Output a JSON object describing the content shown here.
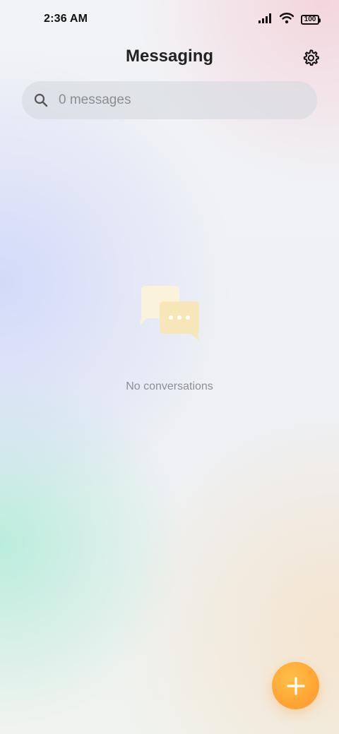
{
  "status_bar": {
    "time": "2:36 AM",
    "battery_level": "100",
    "icons": [
      "signal-icon",
      "wifi-icon",
      "battery-icon"
    ]
  },
  "header": {
    "title": "Messaging",
    "settings_icon": "gear-icon"
  },
  "search": {
    "placeholder": "0 messages",
    "icon": "search-icon"
  },
  "empty_state": {
    "message": "No conversations",
    "icon": "chat-bubbles-icon"
  },
  "fab": {
    "icon": "plus-icon",
    "color": "#FFA534"
  },
  "colors": {
    "accent": "#FFA534",
    "title_text": "#222222",
    "muted_text": "#8C8F94",
    "search_bg": "#DADCE1"
  }
}
